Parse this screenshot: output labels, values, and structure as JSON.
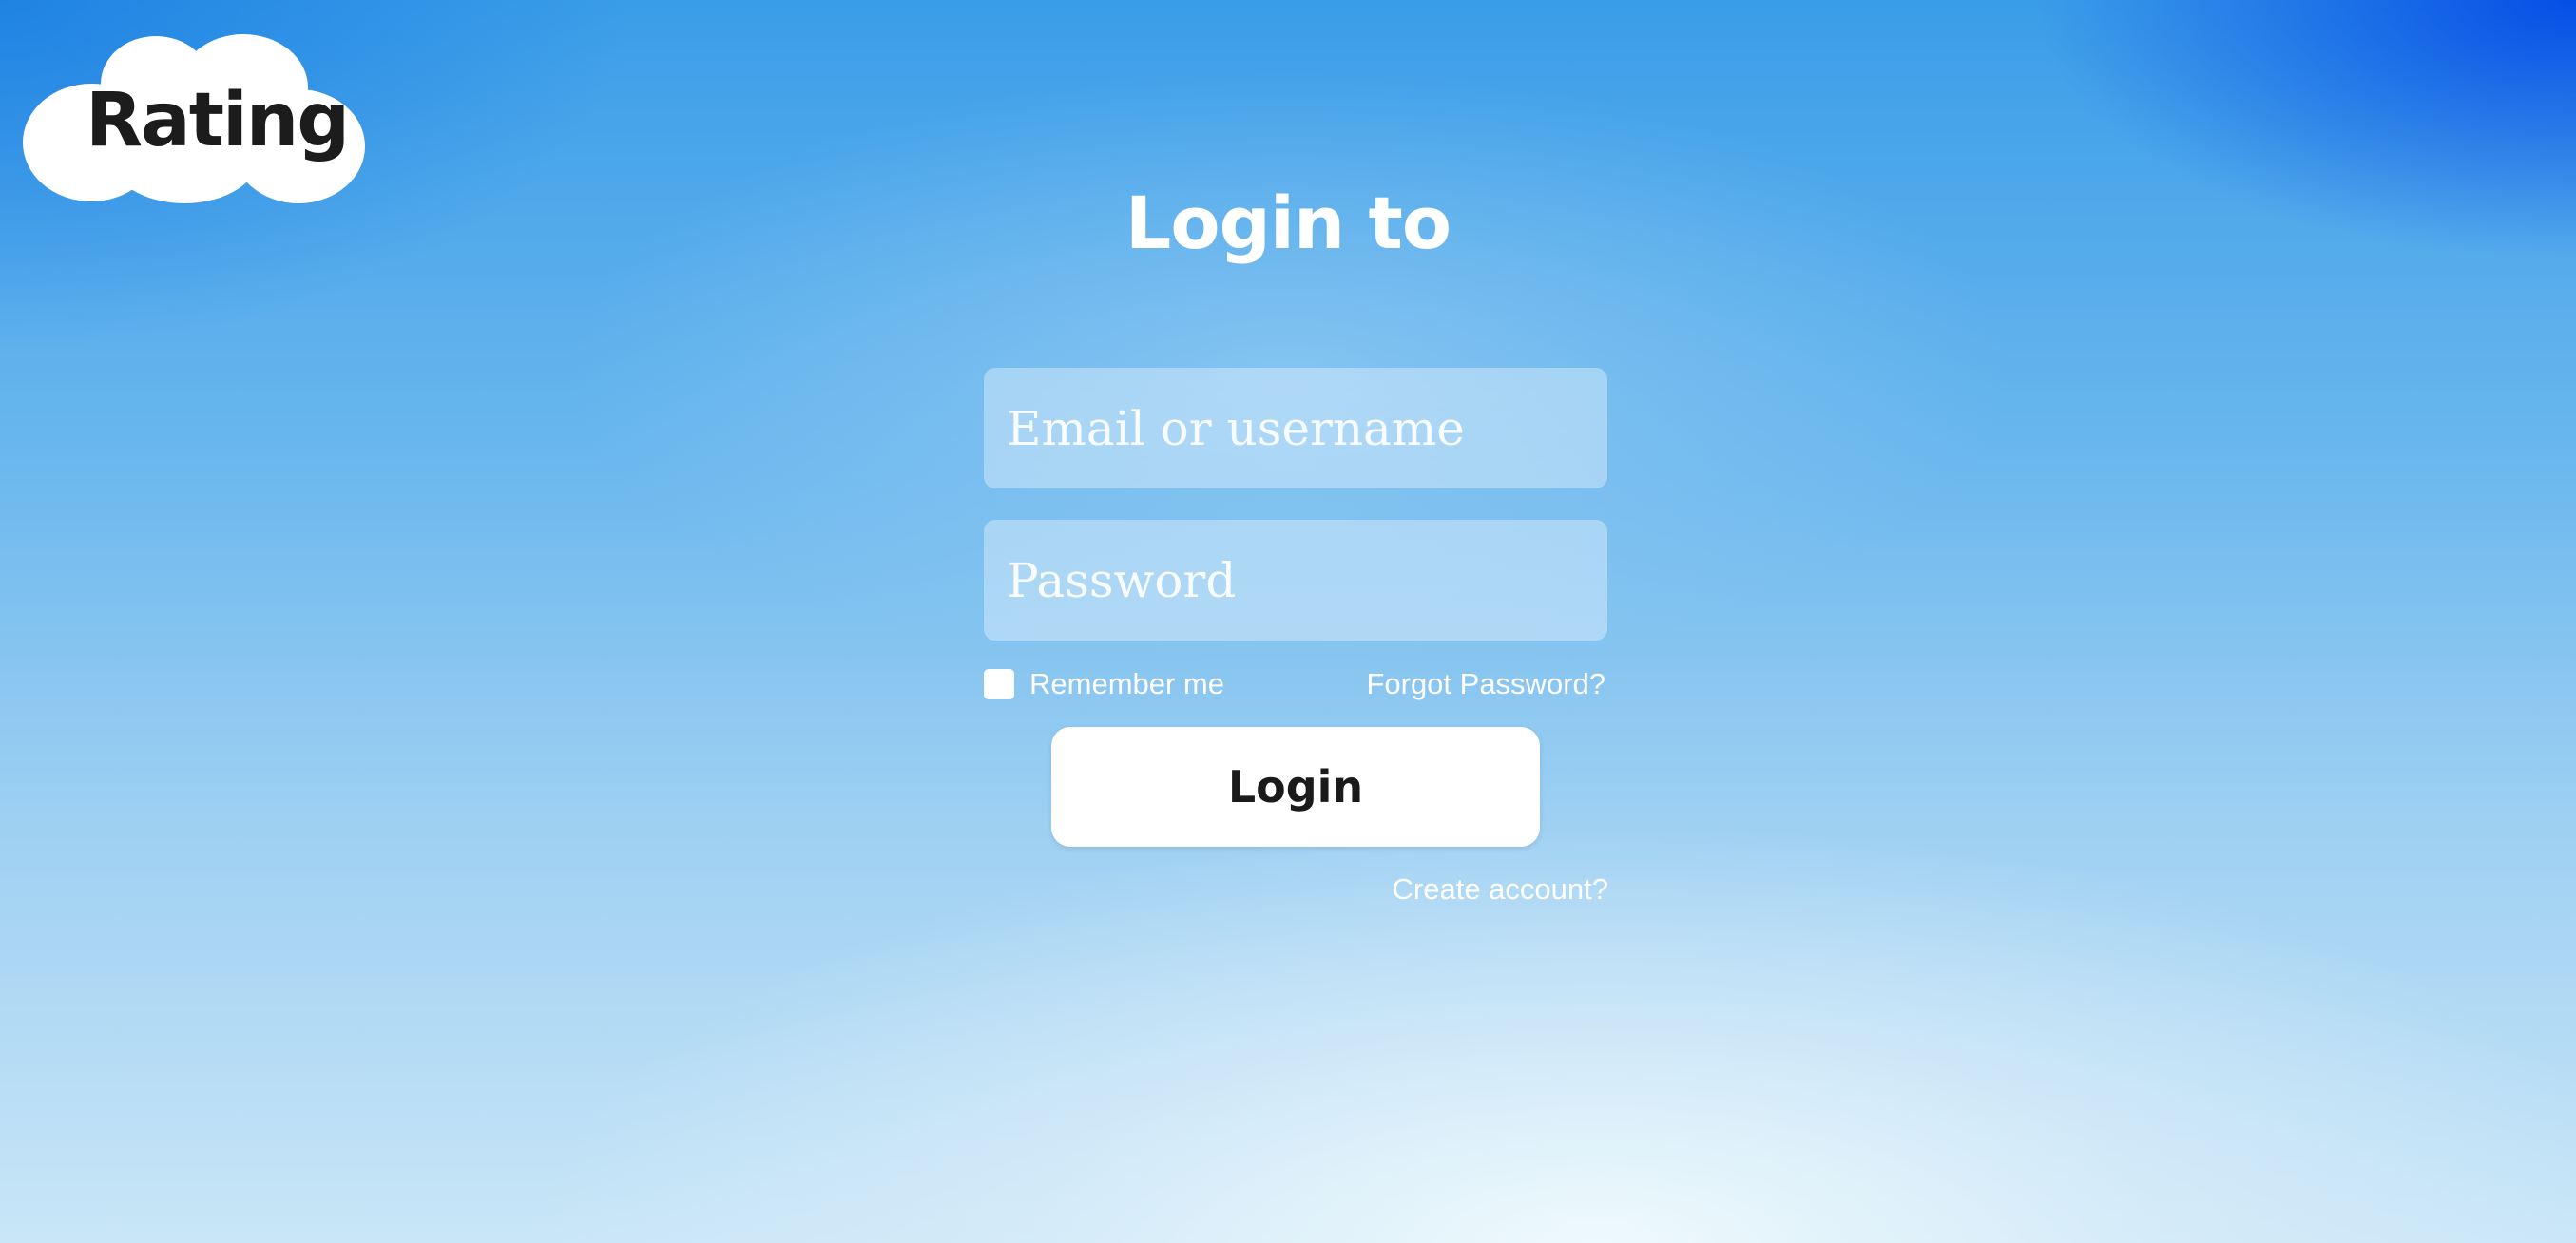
{
  "logo": {
    "text": "Rating",
    "icon": "cloud-icon"
  },
  "page": {
    "title": "Login to"
  },
  "form": {
    "email_placeholder": "Email or username",
    "email_value": "",
    "password_placeholder": "Password",
    "password_value": "",
    "remember_label": "Remember me",
    "remember_checked": false,
    "forgot_label": "Forgot Password?",
    "login_label": "Login",
    "create_label": "Create account?"
  },
  "colors": {
    "accent": "#2b8fe6",
    "text_light": "#ffffff",
    "text_dark": "#1c1c1c"
  }
}
